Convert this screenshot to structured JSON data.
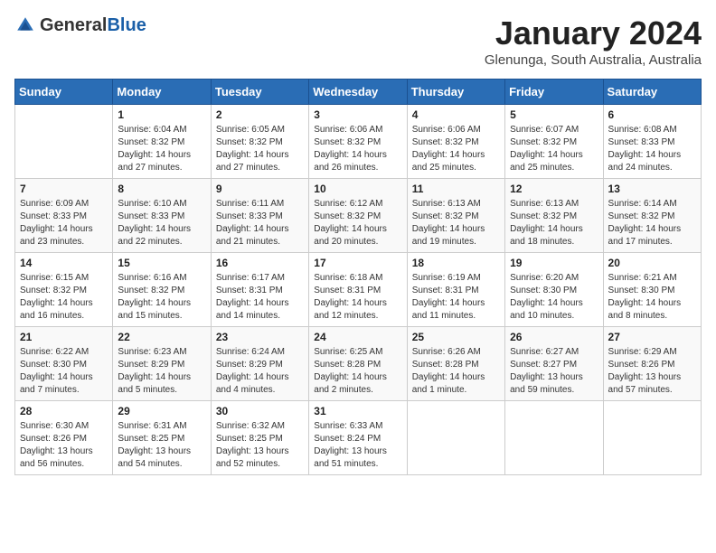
{
  "header": {
    "logo_general": "General",
    "logo_blue": "Blue",
    "month_title": "January 2024",
    "location": "Glenunga, South Australia, Australia"
  },
  "days_of_week": [
    "Sunday",
    "Monday",
    "Tuesday",
    "Wednesday",
    "Thursday",
    "Friday",
    "Saturday"
  ],
  "weeks": [
    [
      {
        "day": "",
        "sunrise": "",
        "sunset": "",
        "daylight": ""
      },
      {
        "day": "1",
        "sunrise": "Sunrise: 6:04 AM",
        "sunset": "Sunset: 8:32 PM",
        "daylight": "Daylight: 14 hours and 27 minutes."
      },
      {
        "day": "2",
        "sunrise": "Sunrise: 6:05 AM",
        "sunset": "Sunset: 8:32 PM",
        "daylight": "Daylight: 14 hours and 27 minutes."
      },
      {
        "day": "3",
        "sunrise": "Sunrise: 6:06 AM",
        "sunset": "Sunset: 8:32 PM",
        "daylight": "Daylight: 14 hours and 26 minutes."
      },
      {
        "day": "4",
        "sunrise": "Sunrise: 6:06 AM",
        "sunset": "Sunset: 8:32 PM",
        "daylight": "Daylight: 14 hours and 25 minutes."
      },
      {
        "day": "5",
        "sunrise": "Sunrise: 6:07 AM",
        "sunset": "Sunset: 8:32 PM",
        "daylight": "Daylight: 14 hours and 25 minutes."
      },
      {
        "day": "6",
        "sunrise": "Sunrise: 6:08 AM",
        "sunset": "Sunset: 8:33 PM",
        "daylight": "Daylight: 14 hours and 24 minutes."
      }
    ],
    [
      {
        "day": "7",
        "sunrise": "Sunrise: 6:09 AM",
        "sunset": "Sunset: 8:33 PM",
        "daylight": "Daylight: 14 hours and 23 minutes."
      },
      {
        "day": "8",
        "sunrise": "Sunrise: 6:10 AM",
        "sunset": "Sunset: 8:33 PM",
        "daylight": "Daylight: 14 hours and 22 minutes."
      },
      {
        "day": "9",
        "sunrise": "Sunrise: 6:11 AM",
        "sunset": "Sunset: 8:33 PM",
        "daylight": "Daylight: 14 hours and 21 minutes."
      },
      {
        "day": "10",
        "sunrise": "Sunrise: 6:12 AM",
        "sunset": "Sunset: 8:32 PM",
        "daylight": "Daylight: 14 hours and 20 minutes."
      },
      {
        "day": "11",
        "sunrise": "Sunrise: 6:13 AM",
        "sunset": "Sunset: 8:32 PM",
        "daylight": "Daylight: 14 hours and 19 minutes."
      },
      {
        "day": "12",
        "sunrise": "Sunrise: 6:13 AM",
        "sunset": "Sunset: 8:32 PM",
        "daylight": "Daylight: 14 hours and 18 minutes."
      },
      {
        "day": "13",
        "sunrise": "Sunrise: 6:14 AM",
        "sunset": "Sunset: 8:32 PM",
        "daylight": "Daylight: 14 hours and 17 minutes."
      }
    ],
    [
      {
        "day": "14",
        "sunrise": "Sunrise: 6:15 AM",
        "sunset": "Sunset: 8:32 PM",
        "daylight": "Daylight: 14 hours and 16 minutes."
      },
      {
        "day": "15",
        "sunrise": "Sunrise: 6:16 AM",
        "sunset": "Sunset: 8:32 PM",
        "daylight": "Daylight: 14 hours and 15 minutes."
      },
      {
        "day": "16",
        "sunrise": "Sunrise: 6:17 AM",
        "sunset": "Sunset: 8:31 PM",
        "daylight": "Daylight: 14 hours and 14 minutes."
      },
      {
        "day": "17",
        "sunrise": "Sunrise: 6:18 AM",
        "sunset": "Sunset: 8:31 PM",
        "daylight": "Daylight: 14 hours and 12 minutes."
      },
      {
        "day": "18",
        "sunrise": "Sunrise: 6:19 AM",
        "sunset": "Sunset: 8:31 PM",
        "daylight": "Daylight: 14 hours and 11 minutes."
      },
      {
        "day": "19",
        "sunrise": "Sunrise: 6:20 AM",
        "sunset": "Sunset: 8:30 PM",
        "daylight": "Daylight: 14 hours and 10 minutes."
      },
      {
        "day": "20",
        "sunrise": "Sunrise: 6:21 AM",
        "sunset": "Sunset: 8:30 PM",
        "daylight": "Daylight: 14 hours and 8 minutes."
      }
    ],
    [
      {
        "day": "21",
        "sunrise": "Sunrise: 6:22 AM",
        "sunset": "Sunset: 8:30 PM",
        "daylight": "Daylight: 14 hours and 7 minutes."
      },
      {
        "day": "22",
        "sunrise": "Sunrise: 6:23 AM",
        "sunset": "Sunset: 8:29 PM",
        "daylight": "Daylight: 14 hours and 5 minutes."
      },
      {
        "day": "23",
        "sunrise": "Sunrise: 6:24 AM",
        "sunset": "Sunset: 8:29 PM",
        "daylight": "Daylight: 14 hours and 4 minutes."
      },
      {
        "day": "24",
        "sunrise": "Sunrise: 6:25 AM",
        "sunset": "Sunset: 8:28 PM",
        "daylight": "Daylight: 14 hours and 2 minutes."
      },
      {
        "day": "25",
        "sunrise": "Sunrise: 6:26 AM",
        "sunset": "Sunset: 8:28 PM",
        "daylight": "Daylight: 14 hours and 1 minute."
      },
      {
        "day": "26",
        "sunrise": "Sunrise: 6:27 AM",
        "sunset": "Sunset: 8:27 PM",
        "daylight": "Daylight: 13 hours and 59 minutes."
      },
      {
        "day": "27",
        "sunrise": "Sunrise: 6:29 AM",
        "sunset": "Sunset: 8:26 PM",
        "daylight": "Daylight: 13 hours and 57 minutes."
      }
    ],
    [
      {
        "day": "28",
        "sunrise": "Sunrise: 6:30 AM",
        "sunset": "Sunset: 8:26 PM",
        "daylight": "Daylight: 13 hours and 56 minutes."
      },
      {
        "day": "29",
        "sunrise": "Sunrise: 6:31 AM",
        "sunset": "Sunset: 8:25 PM",
        "daylight": "Daylight: 13 hours and 54 minutes."
      },
      {
        "day": "30",
        "sunrise": "Sunrise: 6:32 AM",
        "sunset": "Sunset: 8:25 PM",
        "daylight": "Daylight: 13 hours and 52 minutes."
      },
      {
        "day": "31",
        "sunrise": "Sunrise: 6:33 AM",
        "sunset": "Sunset: 8:24 PM",
        "daylight": "Daylight: 13 hours and 51 minutes."
      },
      {
        "day": "",
        "sunrise": "",
        "sunset": "",
        "daylight": ""
      },
      {
        "day": "",
        "sunrise": "",
        "sunset": "",
        "daylight": ""
      },
      {
        "day": "",
        "sunrise": "",
        "sunset": "",
        "daylight": ""
      }
    ]
  ]
}
